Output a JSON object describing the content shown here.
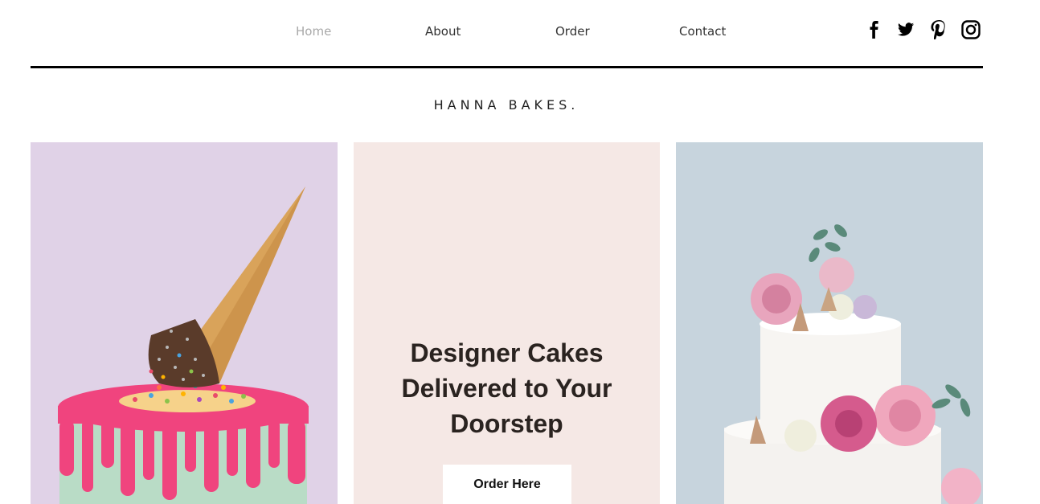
{
  "nav": {
    "items": [
      {
        "label": "Home",
        "active": true
      },
      {
        "label": "About",
        "active": false
      },
      {
        "label": "Order",
        "active": false
      },
      {
        "label": "Contact",
        "active": false
      }
    ],
    "social": [
      "facebook-icon",
      "twitter-icon",
      "pinterest-icon",
      "instagram-icon"
    ]
  },
  "brand": {
    "name": "HANNA BAKES."
  },
  "hero": {
    "headline": "Designer Cakes Delivered to Your Doorstep",
    "cta_label": "Order Here",
    "left_image": "ice-cream-cone-drip-cake",
    "right_image": "white-tiered-cake-with-roses"
  },
  "colors": {
    "left_panel": "#e0d2e7",
    "mid_panel": "#f5e8e5",
    "right_panel": "#c7d4dd",
    "drip_pink": "#f0447e",
    "cake_mint": "#b9dcc6",
    "cone": "#d9a35a"
  }
}
